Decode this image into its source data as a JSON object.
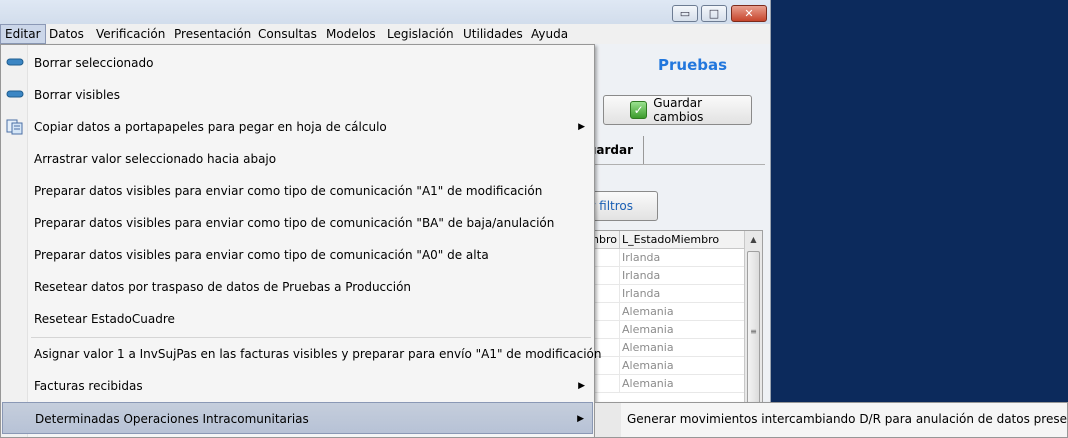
{
  "titlebar": {
    "minimize_label": "▭",
    "maximize_label": "□",
    "close_label": "✕"
  },
  "menubar": [
    "Editar",
    "Datos",
    "Verificación",
    "Presentación",
    "Consultas",
    "Modelos",
    "Legislación",
    "Utilidades",
    "Ayuda"
  ],
  "header": {
    "title": "Pruebas",
    "save_button": "Guardar cambios"
  },
  "tab": {
    "label": "uardar"
  },
  "filters_button": "ar filtros",
  "grid": {
    "columns": [
      "mbro",
      "L_EstadoMiembro"
    ],
    "rows": [
      "Irlanda",
      "Irlanda",
      "Irlanda",
      "Alemania",
      "Alemania",
      "Alemania",
      "Alemania",
      "Alemania"
    ]
  },
  "edit_menu": {
    "items": [
      {
        "label": "Borrar seleccionado",
        "icon": "delete-selected-icon",
        "submenu": false
      },
      {
        "label": "Borrar visibles",
        "icon": "delete-visible-icon",
        "submenu": false
      },
      {
        "label": "Copiar datos a portapapeles para pegar en hoja de cálculo",
        "icon": "copy-spreadsheet-icon",
        "submenu": true
      },
      {
        "label": "Arrastrar valor seleccionado hacia abajo",
        "icon": "",
        "submenu": false
      },
      {
        "label": "Preparar datos visibles para enviar como tipo de comunicación \"A1\" de modificación",
        "icon": "",
        "submenu": false
      },
      {
        "label": "Preparar datos visibles para enviar como tipo de comunicación \"BA\" de baja/anulación",
        "icon": "",
        "submenu": false
      },
      {
        "label": "Preparar datos visibles para enviar como tipo de comunicación \"A0\" de alta",
        "icon": "",
        "submenu": false
      },
      {
        "label": "Resetear datos por traspaso de datos de Pruebas a Producción",
        "icon": "",
        "submenu": false
      },
      {
        "label": "Resetear EstadoCuadre",
        "icon": "",
        "submenu": false
      },
      {
        "label": "Asignar valor 1 a InvSujPas en las facturas visibles y preparar para envío \"A1\" de modificación",
        "icon": "",
        "submenu": false
      },
      {
        "label": "Facturas recibidas",
        "icon": "",
        "submenu": true
      },
      {
        "label": "Determinadas Operaciones Intracomunitarias",
        "icon": "",
        "submenu": true
      }
    ],
    "arrow": "▶"
  },
  "submenu": {
    "label": "Generar movimientos intercambiando D/R para anulación de datos presentados"
  },
  "colors": {
    "accent": "#2277dd",
    "desktop": "#0c2a5c",
    "highlight": "#b7c2d6"
  }
}
